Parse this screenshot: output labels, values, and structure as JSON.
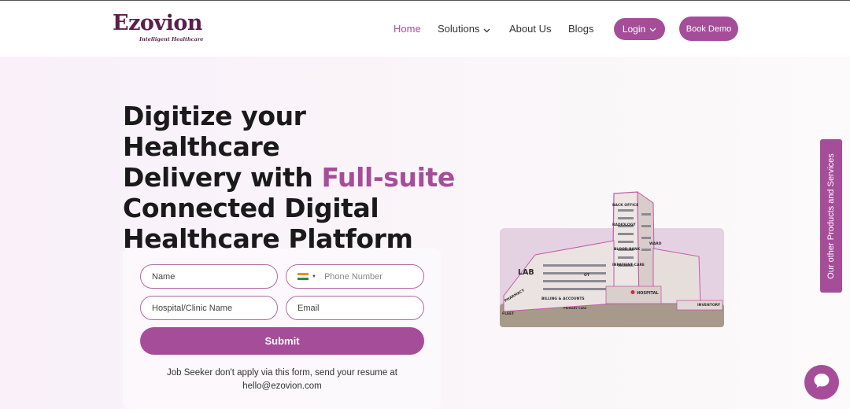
{
  "brand": {
    "name": "Ezovion",
    "tagline": "Intelligent Healthcare"
  },
  "nav": {
    "items": [
      {
        "label": "Home",
        "active": true
      },
      {
        "label": "Solutions",
        "has_dropdown": true
      },
      {
        "label": "About Us"
      },
      {
        "label": "Blogs"
      }
    ],
    "login_label": "Login",
    "demo_label": "Book Demo"
  },
  "hero": {
    "line1": "Digitize your Healthcare",
    "line2_prefix": "Delivery with ",
    "line2_accent": "Full-suite",
    "line3": "Connected Digital",
    "line4": "Healthcare Platform"
  },
  "form": {
    "name_placeholder": "Name",
    "phone_placeholder": "Phone Number",
    "hospital_placeholder": "Hospital/Clinic Name",
    "email_placeholder": "Email",
    "submit_label": "Submit",
    "note_line1": "Job Seeker don't apply via this form, send your resume at",
    "note_line2": "hello@ezovion.com"
  },
  "illustration": {
    "labels": [
      "BACK OFFICE",
      "RADIOLOGY",
      "WARD",
      "BLOOD BANK",
      "INPATIENT CARE",
      "LAB",
      "OT",
      "PHARMACY",
      "BILLING & ACCOUNTS",
      "PRIMARY CARE",
      "HOSPITAL",
      "INVENTORY",
      "FLEET"
    ]
  },
  "side_tab": {
    "label": "Our other Products and Services"
  },
  "colors": {
    "accent": "#a64d9a",
    "brand_dark": "#5a1f4c"
  },
  "icons": {
    "chat": "chat-bubble-icon",
    "dropdown": "chevron-down-icon",
    "flag": "india-flag-icon"
  }
}
